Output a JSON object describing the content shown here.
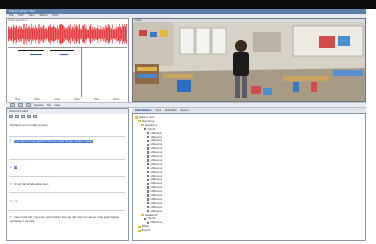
{
  "window": {
    "title": "Transcription Tool",
    "menu": [
      "File",
      "Edit",
      "Tiers",
      "Media",
      "Help"
    ]
  },
  "waveform_panel": {
    "label": "Audio waveform",
    "transport_buttons": [
      "Play",
      "Stop",
      "Loop",
      "Slow",
      "Fast",
      "Zoom"
    ]
  },
  "video_panel": {
    "header": "Video"
  },
  "toolbar": {
    "items": [
      "Speaker",
      "Tier",
      "View"
    ]
  },
  "transcript": {
    "header": "Transcript editor",
    "segments": [
      {
        "num": "",
        "text": "Kinderen en ik praten samen"
      },
      {
        "num": "1",
        "text": "Jij Je bent ik heb gedacht dat een paar dingen samen maken",
        "highlight": true
      },
      {
        "num": "2",
        "text": "Ja",
        "highlight": true
      },
      {
        "num": "3",
        "text": "Ik wil dat straks laten zien"
      },
      {
        "num": "4",
        "text": "( )"
      },
      {
        "num": "5",
        "text": "Dan moet het nog even goed kijken hoe we dat doen en wie er mee gaat helpen vandaag in de klas"
      }
    ]
  },
  "right_tabs": {
    "tabs": [
      "Annotations",
      "Tiers",
      "Metadata",
      "Search"
    ],
    "active": "Annotations"
  },
  "tree": {
    "items": [
      {
        "label": "Session root",
        "level": 0,
        "folder": true
      },
      {
        "label": "Recording",
        "level": 1,
        "folder": true
      },
      {
        "label": "Speaker A",
        "level": 2,
        "folder": true
      },
      {
        "label": "Tier 01",
        "level": 3
      },
      {
        "label": "utterance",
        "level": 4
      },
      {
        "label": "utterance",
        "level": 4
      },
      {
        "label": "utterance",
        "level": 4
      },
      {
        "label": "utterance",
        "level": 4
      },
      {
        "label": "utterance",
        "level": 4
      },
      {
        "label": "utterance",
        "level": 4
      },
      {
        "label": "utterance",
        "level": 4
      },
      {
        "label": "utterance",
        "level": 4
      },
      {
        "label": "utterance",
        "level": 4
      },
      {
        "label": "utterance",
        "level": 4
      },
      {
        "label": "utterance",
        "level": 4
      },
      {
        "label": "utterance",
        "level": 4
      },
      {
        "label": "utterance",
        "level": 4
      },
      {
        "label": "utterance",
        "level": 4
      },
      {
        "label": "utterance",
        "level": 4
      },
      {
        "label": "utterance",
        "level": 4
      },
      {
        "label": "utterance",
        "level": 4
      },
      {
        "label": "utterance",
        "level": 4
      },
      {
        "label": "utterance",
        "level": 4
      },
      {
        "label": "utterance",
        "level": 4
      },
      {
        "label": "utterance",
        "level": 4
      },
      {
        "label": "Speaker B",
        "level": 2,
        "folder": true
      },
      {
        "label": "Tier 02",
        "level": 3
      },
      {
        "label": "utterance",
        "level": 4
      },
      {
        "label": "Notes",
        "level": 1,
        "folder": true
      },
      {
        "label": "Export",
        "level": 1,
        "folder": true
      }
    ]
  },
  "colors": {
    "waveform": "#e0262b",
    "highlight": "#3f6fd4",
    "accent": "#5a7fa8"
  }
}
